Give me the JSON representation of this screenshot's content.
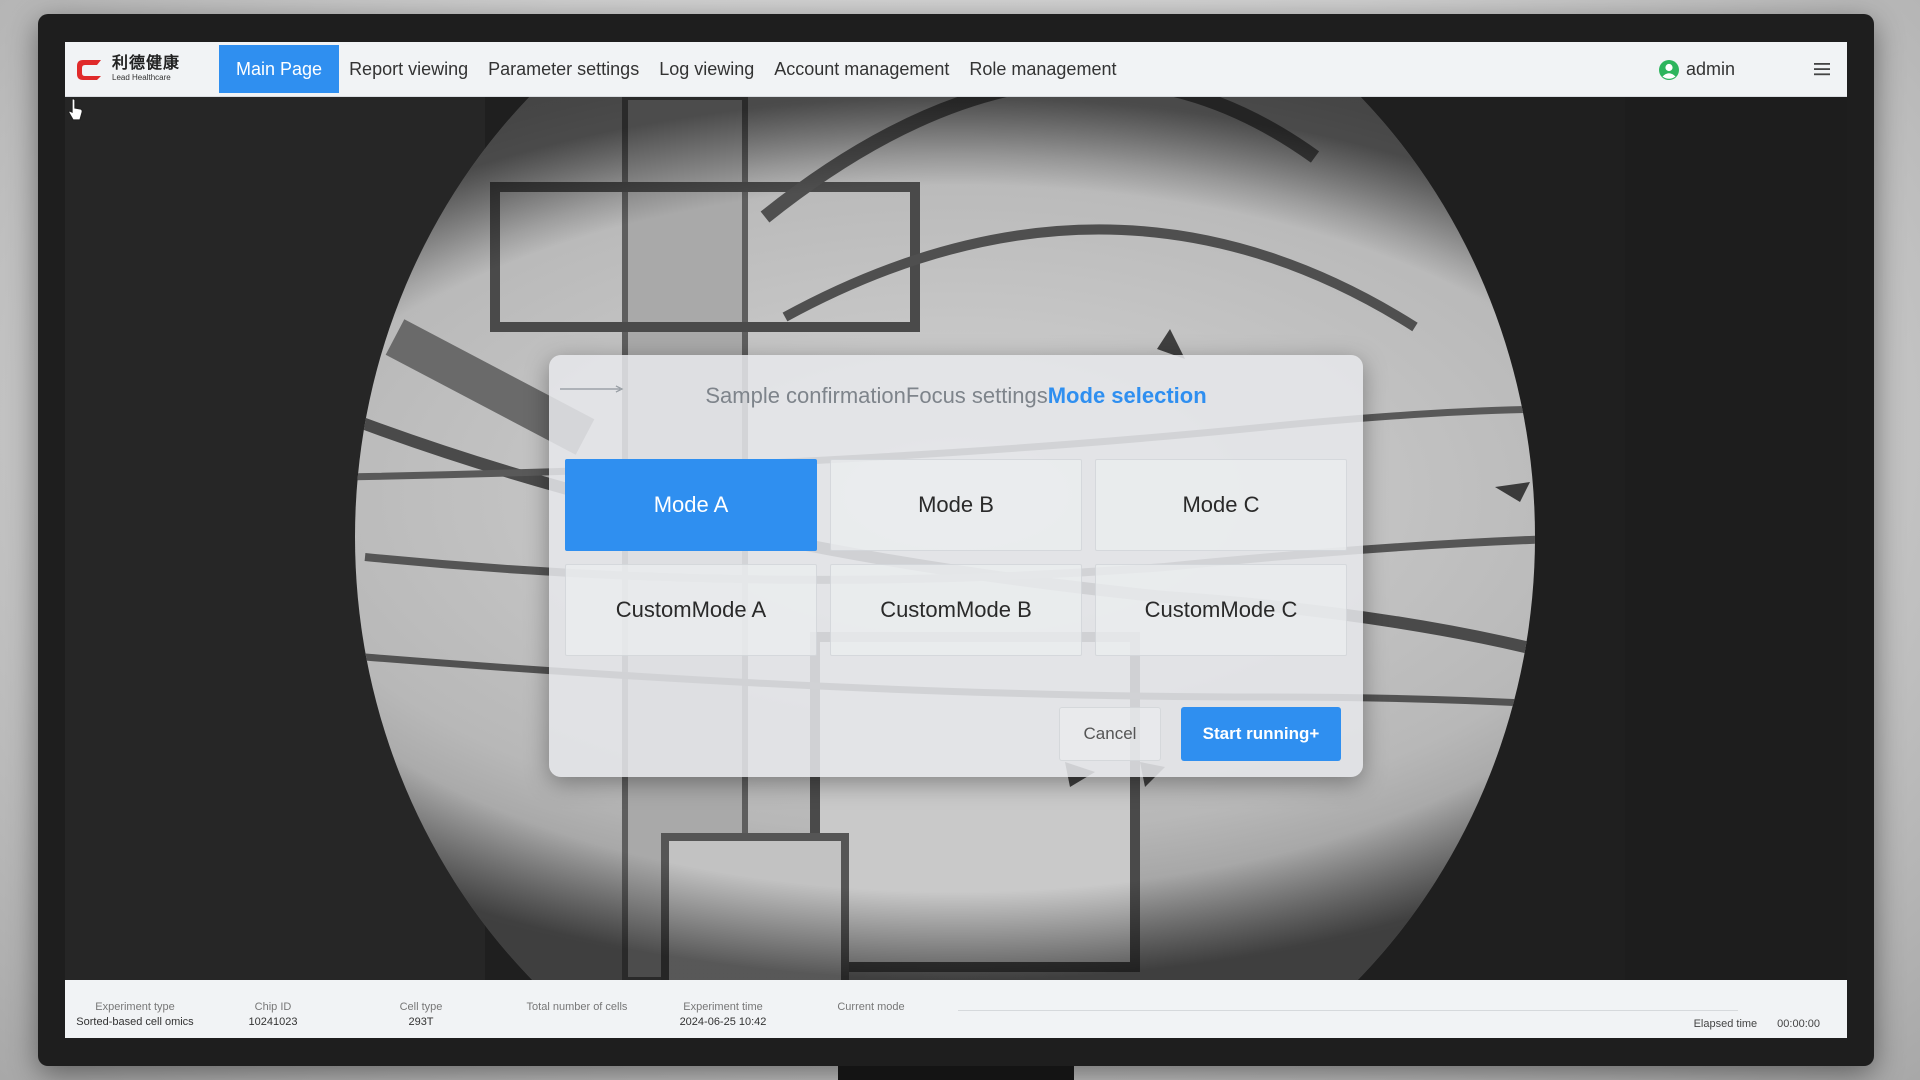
{
  "app": {
    "logo_cn": "利德健康",
    "logo_en": "Lead Healthcare"
  },
  "nav": {
    "tabs": [
      {
        "label": "Main Page",
        "active": true
      },
      {
        "label": "Report viewing"
      },
      {
        "label": "Parameter settings"
      },
      {
        "label": "Log viewing"
      },
      {
        "label": "Account management"
      },
      {
        "label": "Role management"
      }
    ],
    "user": "admin",
    "icons": {
      "user": "user-circle-icon",
      "menu": "hamburger-menu-icon"
    }
  },
  "wizard": {
    "steps": [
      {
        "label": "Sample confirmation"
      },
      {
        "label": "Focus settings"
      },
      {
        "label": "Mode selection",
        "current": true
      }
    ],
    "modes": [
      {
        "label": "Mode A",
        "selected": true
      },
      {
        "label": "Mode B"
      },
      {
        "label": "Mode C"
      },
      {
        "label": "CustomMode A"
      },
      {
        "label": "CustomMode B"
      },
      {
        "label": "CustomMode C"
      }
    ],
    "cancel_label": "Cancel",
    "start_label": "Start running+"
  },
  "status": {
    "experiment_type_label": "Experiment type",
    "experiment_type_value": "Sorted-based cell omics",
    "chip_id_label": "Chip ID",
    "chip_id_value": "10241023",
    "cell_type_label": "Cell type",
    "cell_type_value": "293T",
    "total_cells_label": "Total number of cells",
    "total_cells_value": "",
    "experiment_time_label": "Experiment time",
    "experiment_time_value": "2024-06-25 10:42",
    "current_mode_label": "Current mode",
    "current_mode_value": "",
    "elapsed_label": "Elapsed time",
    "elapsed_value": "00:00:00"
  },
  "colors": {
    "accent": "#2f8ff0",
    "navbar_bg": "#f1f3f5",
    "logo_red": "#e02a2a",
    "user_green": "#2db55d"
  }
}
